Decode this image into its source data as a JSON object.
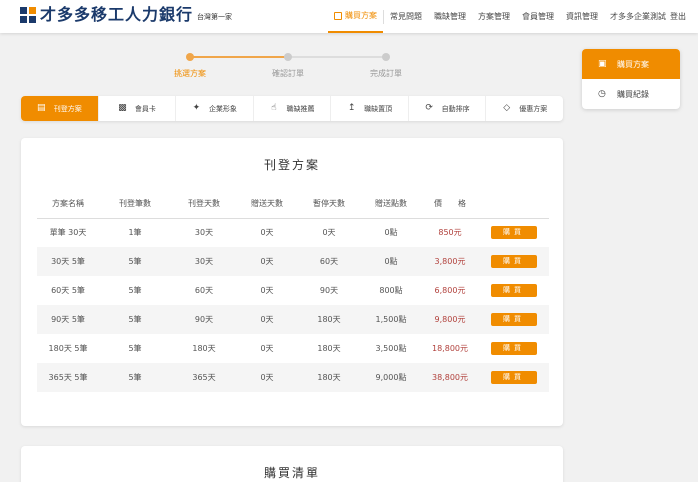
{
  "brand": {
    "name": "才多多移工人力銀行",
    "tagline": "台灣第一家"
  },
  "nav": {
    "items": [
      "購買方案",
      "常見問題",
      "職缺管理",
      "方案管理",
      "會員管理",
      "資訊管理"
    ],
    "user": "才多多企業測試",
    "logout": "登出"
  },
  "stepper": {
    "steps": [
      "挑選方案",
      "確認訂單",
      "完成訂單"
    ],
    "current": 0
  },
  "tabs": [
    "刊登方案",
    "會員卡",
    "企業形象",
    "職缺推薦",
    "職缺置頂",
    "自動排序",
    "優惠方案"
  ],
  "plans": {
    "title": "刊登方案",
    "headers": [
      "方案名稱",
      "刊登筆數",
      "刊登天數",
      "贈送天數",
      "暫停天數",
      "贈送點數",
      "價　　格",
      ""
    ],
    "buy_label": "購買",
    "rows": [
      [
        "單筆 30天",
        "1筆",
        "30天",
        "0天",
        "0天",
        "0點",
        "850元"
      ],
      [
        "30天 5筆",
        "5筆",
        "30天",
        "0天",
        "60天",
        "0點",
        "3,800元"
      ],
      [
        "60天 5筆",
        "5筆",
        "60天",
        "0天",
        "90天",
        "800點",
        "6,800元"
      ],
      [
        "90天 5筆",
        "5筆",
        "90天",
        "0天",
        "180天",
        "1,500點",
        "9,800元"
      ],
      [
        "180天 5筆",
        "5筆",
        "180天",
        "0天",
        "180天",
        "3,500點",
        "18,800元"
      ],
      [
        "365天 5筆",
        "5筆",
        "365天",
        "0天",
        "180天",
        "9,000點",
        "38,800元"
      ]
    ]
  },
  "cart": {
    "title": "購買清單"
  },
  "side_menu": [
    "購買方案",
    "購買紀錄"
  ],
  "colors": {
    "accent": "#f08c00",
    "brand": "#1b3a6b",
    "price": "#b1413c"
  }
}
